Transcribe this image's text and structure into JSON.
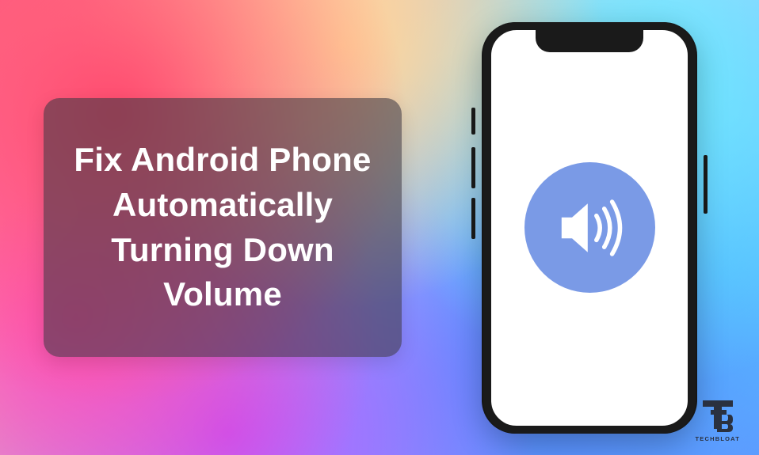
{
  "headline": "Fix Android Phone Automatically Turning Down Volume",
  "brand": {
    "name": "TECHBLOAT"
  },
  "icon": {
    "name": "speaker-icon",
    "badge_color": "#7a9ae6"
  }
}
